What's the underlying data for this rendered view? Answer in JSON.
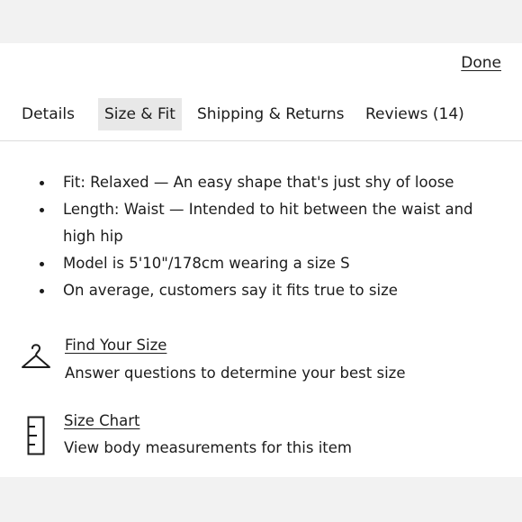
{
  "header": {
    "done_label": "Done"
  },
  "tabs": [
    {
      "label": "Details"
    },
    {
      "label": "Size & Fit"
    },
    {
      "label": "Shipping & Returns"
    },
    {
      "label": "Reviews (14)"
    }
  ],
  "active_tab": "Size & Fit",
  "fit_notes": [
    "Fit: Relaxed — An easy shape that's just shy of loose",
    "Length: Waist — Intended to hit between the waist and high hip",
    "Model is 5'10\"/178cm wearing a size S",
    "On average, customers say it fits true to size"
  ],
  "find_your_size": {
    "icon": "hanger-icon",
    "title": "Find Your Size",
    "description": "Answer questions to determine your best size"
  },
  "size_chart": {
    "icon": "ruler-icon",
    "title": "Size Chart",
    "description": "View body measurements for this item"
  }
}
